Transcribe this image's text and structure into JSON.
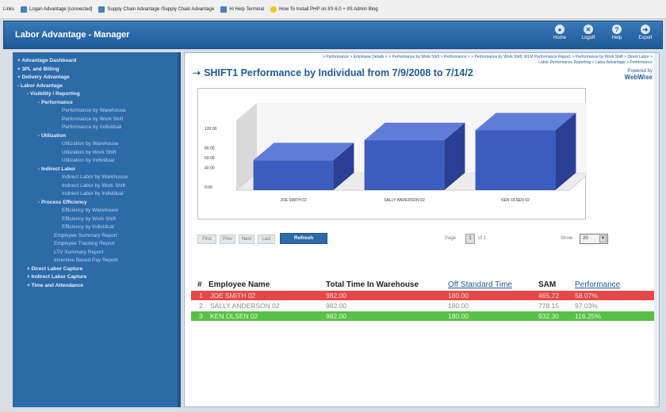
{
  "links_bar": [
    {
      "label": "Links",
      "icon": "none"
    },
    {
      "label": "Logan Advantage [connected]",
      "icon": "page-icon"
    },
    {
      "label": "Supply Chain Advantage /Supply Chain Advantage",
      "icon": "page-icon"
    },
    {
      "label": "Hi Help Terminal",
      "icon": "page-icon"
    },
    {
      "label": "How To Install PHP on IIS 6.0 + IIS Admin Blog",
      "icon": "star-icon"
    }
  ],
  "app": {
    "title": "Labor Advantage - Manager",
    "header_buttons": [
      {
        "label": "Home",
        "icon": "home-icon",
        "glyph": "●"
      },
      {
        "label": "Logoff",
        "icon": "logoff-icon",
        "glyph": "✕"
      },
      {
        "label": "Help",
        "icon": "help-icon",
        "glyph": "?"
      },
      {
        "label": "Export",
        "icon": "export-icon",
        "glyph": "➜"
      }
    ]
  },
  "sidebar": {
    "items": [
      {
        "label": "+ Advantage Dashboard",
        "level": "l0"
      },
      {
        "label": "+ 3PL and Billing",
        "level": "l0"
      },
      {
        "label": "+ Delivery Advantage",
        "level": "l0"
      },
      {
        "label": "- Labor Advantage",
        "level": "l0"
      },
      {
        "label": "- Visibility / Reporting",
        "level": "l1"
      },
      {
        "label": "- Performance",
        "level": "l2"
      },
      {
        "label": "Performance by Warehouse",
        "level": "l3"
      },
      {
        "label": "Performance by Work Shift",
        "level": "l3"
      },
      {
        "label": "Performance by Individual",
        "level": "l3"
      },
      {
        "label": "- Utilization",
        "level": "l2"
      },
      {
        "label": "Utilization by Warehouse",
        "level": "l3"
      },
      {
        "label": "Utilization by Work Shift",
        "level": "l3"
      },
      {
        "label": "Utilization by Individual",
        "level": "l3"
      },
      {
        "label": "- Indirect Labor",
        "level": "l2"
      },
      {
        "label": "Indirect Labor by Warehouse",
        "level": "l3"
      },
      {
        "label": "Indirect Labor by Work Shift",
        "level": "l3"
      },
      {
        "label": "Indirect Labor by Individual",
        "level": "l3"
      },
      {
        "label": "- Process Efficiency",
        "level": "l2"
      },
      {
        "label": "Efficiency by Warehouse",
        "level": "l3"
      },
      {
        "label": "Efficiency by Work Shift",
        "level": "l3"
      },
      {
        "label": "Efficiency by Individual",
        "level": "l3"
      },
      {
        "label": "Employee Summary Report",
        "level": "l3b"
      },
      {
        "label": "Employee Tracking Report",
        "level": "l3b"
      },
      {
        "label": "LTV Summary Report",
        "level": "l3b"
      },
      {
        "label": "Incentive Based Pay Report",
        "level": "l3b"
      },
      {
        "label": "+ Direct Labor Capture",
        "level": "l1"
      },
      {
        "label": "+ Indirect Labor Capture",
        "level": "l1"
      },
      {
        "label": "+ Time and Attendance",
        "level": "l1"
      }
    ]
  },
  "main": {
    "breadcrumb": "> Performance > Employee Details > > Performance by Work Shift > Performance > > Performance by Work Shift, WLM Performance Report, > Performance by Work Shift > Direct Labor > Labor Performance Reporting > Labor Advantage > Performance",
    "page_title": "SHIFT1 Performance by Individual from 7/9/2008 to 7/14/2",
    "logo_line1": "Powered by",
    "logo_line2": "WebWise",
    "pager": {
      "first": "First",
      "prev": "Prev",
      "next": "Next",
      "last": "Last",
      "refresh": "Refresh",
      "page_label": "Page",
      "page_value": "1",
      "of_label": "of 1",
      "show_label": "Show",
      "show_value": "20"
    },
    "table": {
      "columns": [
        "#",
        "Employee Name",
        "Total Time In Warehouse",
        "Off Standard Time",
        "SAM",
        "Performance"
      ],
      "rows": [
        {
          "num": "1",
          "name": "JOE SMITH 02",
          "total": "982.00",
          "off": "180.00",
          "sam": "465.72",
          "perf": "58.07%",
          "color": "red"
        },
        {
          "num": "2",
          "name": "SALLY ANDERSON 02",
          "total": "982.00",
          "off": "180.00",
          "sam": "778.15",
          "perf": "97.03%",
          "color": "white"
        },
        {
          "num": "3",
          "name": "KEN OLSEN 02",
          "total": "982.00",
          "off": "180.00",
          "sam": "932.30",
          "perf": "116.25%",
          "color": "green"
        }
      ]
    }
  },
  "chart_data": {
    "type": "bar",
    "categories": [
      "JOE SMITH 02",
      "SALLY ANDERSON 02",
      "KEN OLSEN 02"
    ],
    "values": [
      58.07,
      97.03,
      116.25
    ],
    "yticks": [
      "0.00",
      "40.00",
      "60.00",
      "80.00",
      "120.00"
    ],
    "ylim": [
      0,
      120
    ],
    "bar_color": "#3d5cc0",
    "title": "",
    "xlabel": "",
    "ylabel": ""
  }
}
